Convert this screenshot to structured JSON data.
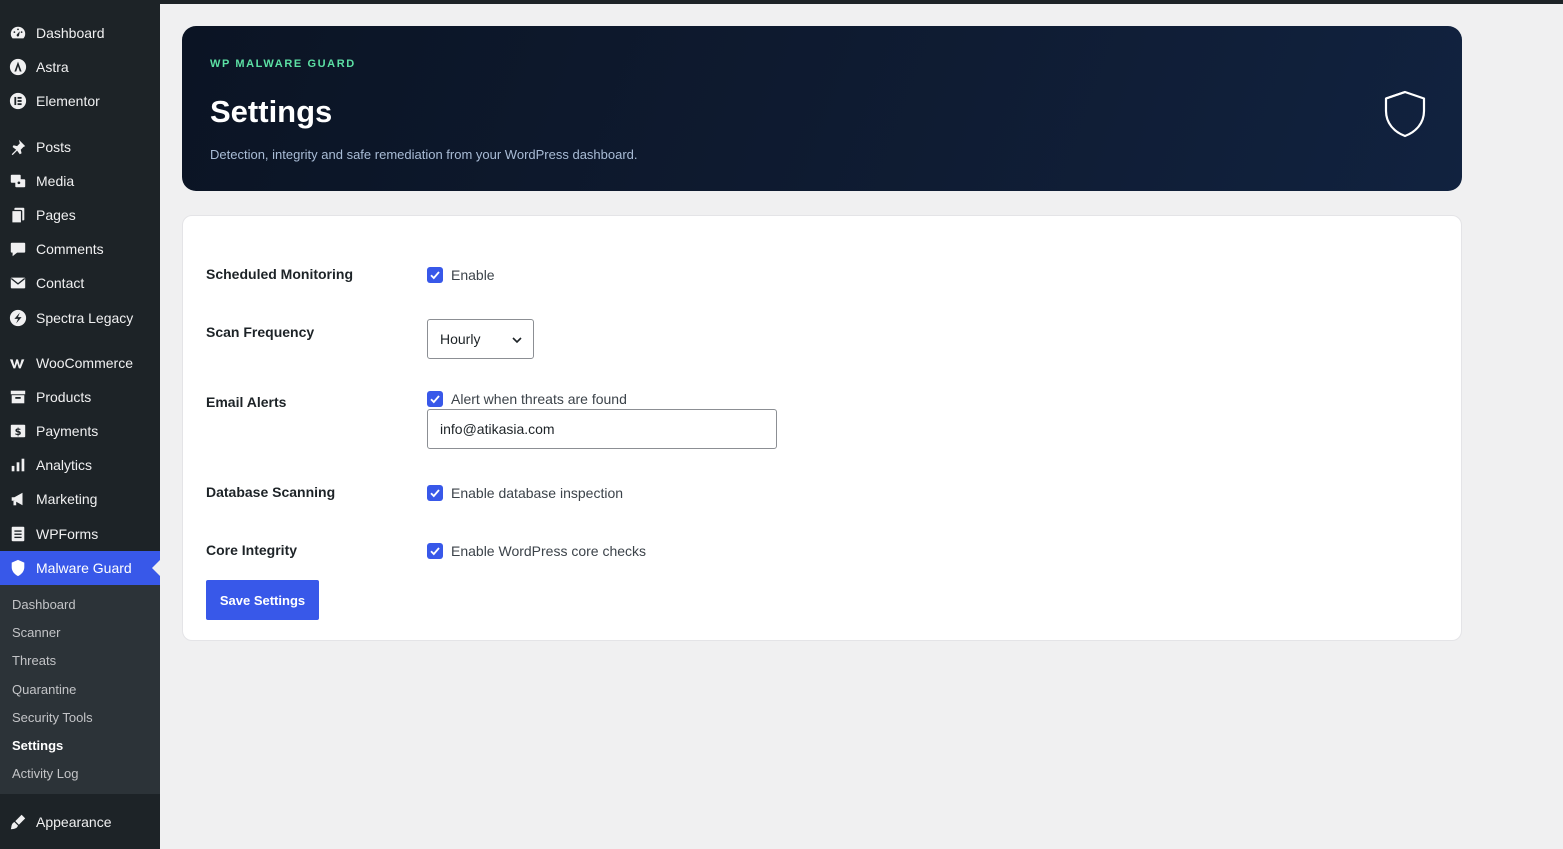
{
  "sidebar": {
    "items": [
      {
        "label": "Dashboard",
        "icon": "dashboard-icon"
      },
      {
        "label": "Astra",
        "icon": "astra-icon"
      },
      {
        "label": "Elementor",
        "icon": "elementor-icon"
      },
      {
        "label": "Posts",
        "icon": "pin-icon"
      },
      {
        "label": "Media",
        "icon": "media-icon"
      },
      {
        "label": "Pages",
        "icon": "pages-icon"
      },
      {
        "label": "Comments",
        "icon": "comment-icon"
      },
      {
        "label": "Contact",
        "icon": "mail-icon"
      },
      {
        "label": "Spectra Legacy",
        "icon": "spectra-icon"
      },
      {
        "label": "WooCommerce",
        "icon": "woocommerce-icon"
      },
      {
        "label": "Products",
        "icon": "archive-icon"
      },
      {
        "label": "Payments",
        "icon": "dollar-icon"
      },
      {
        "label": "Analytics",
        "icon": "chart-bar-icon"
      },
      {
        "label": "Marketing",
        "icon": "megaphone-icon"
      },
      {
        "label": "WPForms",
        "icon": "forms-icon"
      },
      {
        "label": "Malware Guard",
        "icon": "shield-icon"
      },
      {
        "label": "Appearance",
        "icon": "brush-icon"
      }
    ],
    "submenu": [
      "Dashboard",
      "Scanner",
      "Threats",
      "Quarantine",
      "Security Tools",
      "Settings",
      "Activity Log"
    ],
    "active_submenu": "Settings"
  },
  "hero": {
    "eyebrow": "WP MALWARE GUARD",
    "title": "Settings",
    "subtitle": "Detection, integrity and safe remediation from your WordPress dashboard.",
    "icon": "shield-outline-icon"
  },
  "form": {
    "scheduled": {
      "label": "Scheduled Monitoring",
      "checkbox_label": "Enable",
      "checked": true
    },
    "frequency": {
      "label": "Scan Frequency",
      "value": "Hourly"
    },
    "email": {
      "label": "Email Alerts",
      "checkbox_label": "Alert when threats are found",
      "checked": true,
      "value": "info@atikasia.com"
    },
    "database": {
      "label": "Database Scanning",
      "checkbox_label": "Enable database inspection",
      "checked": true
    },
    "core": {
      "label": "Core Integrity",
      "checkbox_label": "Enable WordPress core checks",
      "checked": true
    },
    "save_label": "Save Settings"
  },
  "colors": {
    "accent": "#3858e9",
    "sidebar": "#1d2327",
    "hero_eyebrow": "#5ce0a4"
  }
}
